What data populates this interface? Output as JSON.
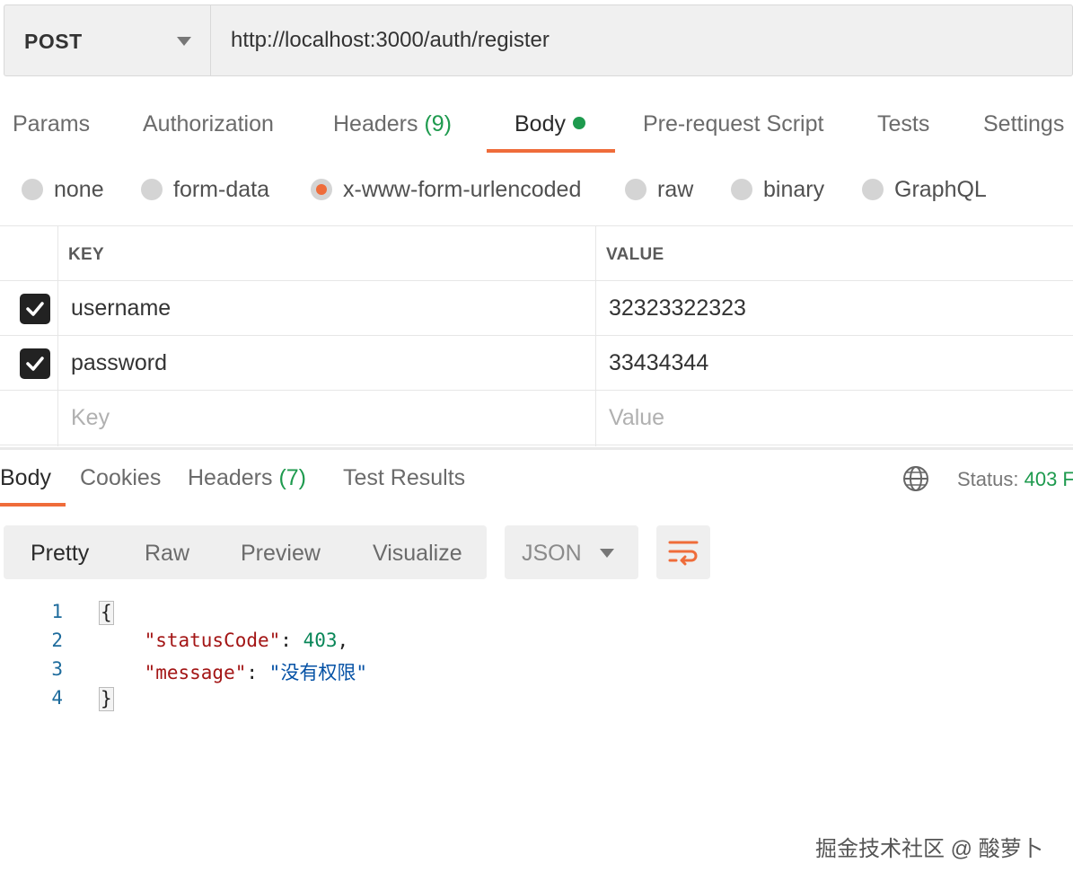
{
  "request": {
    "method": "POST",
    "url": "http://localhost:3000/auth/register"
  },
  "request_tabs": [
    {
      "label": "Params"
    },
    {
      "label": "Authorization"
    },
    {
      "label": "Headers",
      "count": "(9)"
    },
    {
      "label": "Body",
      "active": true
    },
    {
      "label": "Pre-request Script"
    },
    {
      "label": "Tests"
    },
    {
      "label": "Settings"
    }
  ],
  "body_types": [
    {
      "label": "none"
    },
    {
      "label": "form-data"
    },
    {
      "label": "x-www-form-urlencoded",
      "selected": true
    },
    {
      "label": "raw"
    },
    {
      "label": "binary"
    },
    {
      "label": "GraphQL"
    }
  ],
  "kv_table": {
    "headers": {
      "key": "KEY",
      "value": "VALUE"
    },
    "rows": [
      {
        "key": "username",
        "value": "32323322323",
        "checked": true
      },
      {
        "key": "password",
        "value": "33434344",
        "checked": true
      }
    ],
    "placeholder": {
      "key": "Key",
      "value": "Value"
    }
  },
  "response_tabs": [
    {
      "label": "Body",
      "active": true
    },
    {
      "label": "Cookies"
    },
    {
      "label": "Headers",
      "count": "(7)"
    },
    {
      "label": "Test Results"
    }
  ],
  "status": {
    "label": "Status:",
    "value": "403 F"
  },
  "view_modes": [
    "Pretty",
    "Raw",
    "Preview",
    "Visualize"
  ],
  "format": "JSON",
  "code": {
    "line_numbers": [
      "1",
      "2",
      "3",
      "4"
    ],
    "open_brace": "{",
    "close_brace": "}",
    "key1": "\"statusCode\"",
    "sep1": ": ",
    "val1": "403",
    "comma": ",",
    "key2": "\"message\"",
    "sep2": ": ",
    "val2": "\"没有权限\""
  },
  "watermark": "掘金技术社区 @ 酸萝卜",
  "colors": {
    "accent": "#ef6c3a",
    "success": "#1e9a4e"
  }
}
